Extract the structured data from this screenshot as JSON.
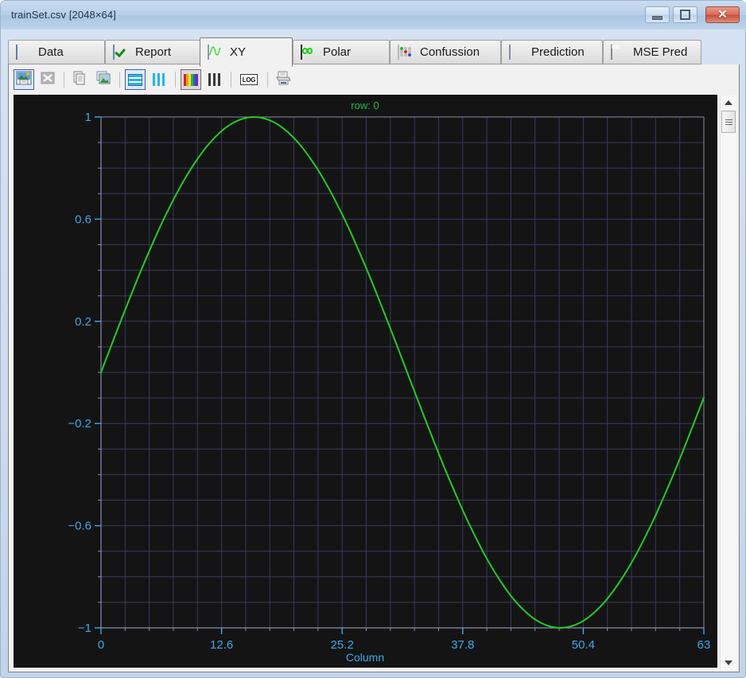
{
  "window": {
    "title": "trainSet.csv [2048×64]",
    "controls": {
      "minimize": "–",
      "maximize": "□",
      "close": "✕"
    }
  },
  "tabs": [
    {
      "label": "Data",
      "icon": "table-grid-icon",
      "active": false
    },
    {
      "label": "Report",
      "icon": "checkmark-icon",
      "active": false
    },
    {
      "label": "XY",
      "icon": "xy-waveform-icon",
      "active": true
    },
    {
      "label": "Polar",
      "icon": "polar-plot-icon",
      "active": false
    },
    {
      "label": "Confussion",
      "icon": "confusion-dots-icon",
      "active": false
    },
    {
      "label": "Prediction",
      "icon": "prediction-grid-icon",
      "active": false
    },
    {
      "label": "MSE Pred",
      "icon": "mse-grid-icon",
      "active": false
    }
  ],
  "toolbar": {
    "buttons": [
      {
        "name": "save-image-button",
        "icon": "save-image-icon",
        "enabled": true,
        "pressed": false,
        "framed": true
      },
      {
        "name": "export-excel-button",
        "icon": "excel-export-icon",
        "enabled": false,
        "pressed": false,
        "framed": false
      },
      {
        "name": "copy-data-button",
        "icon": "copy-pages-icon",
        "enabled": true,
        "pressed": false,
        "framed": false
      },
      {
        "name": "copy-image-button",
        "icon": "copy-image-icon",
        "enabled": true,
        "pressed": false,
        "framed": false
      },
      {
        "name": "horizontal-bars-button",
        "icon": "horizontal-bars-icon",
        "enabled": true,
        "pressed": false,
        "framed": true
      },
      {
        "name": "vertical-bars-button",
        "icon": "vertical-bars-icon",
        "enabled": true,
        "pressed": false,
        "framed": false
      },
      {
        "name": "color-palette-button",
        "icon": "color-bars-icon",
        "enabled": true,
        "pressed": true,
        "framed": false
      },
      {
        "name": "grayscale-palette-button",
        "icon": "gray-bars-icon",
        "enabled": true,
        "pressed": false,
        "framed": false
      },
      {
        "name": "log-scale-button",
        "icon": "log-icon",
        "enabled": true,
        "pressed": false,
        "framed": false,
        "label": "LOG"
      },
      {
        "name": "print-button",
        "icon": "printer-icon",
        "enabled": true,
        "pressed": false,
        "framed": false
      }
    ]
  },
  "scrollbar": {
    "up_arrow": "▲",
    "down_arrow": "▼"
  },
  "colors": {
    "plot_background": "#141414",
    "grid": "#39395f",
    "axis": "#8a8ab0",
    "series": "#22cc22",
    "tick_label": "#3aa9e8",
    "title": "#22bb44",
    "axis_label": "#3aa9e8"
  },
  "chart_data": {
    "type": "line",
    "title": "row: 0",
    "xlabel": "Column",
    "ylabel": "",
    "xlim": [
      0,
      63
    ],
    "ylim": [
      -1,
      1
    ],
    "xticks": [
      0,
      12.6,
      25.2,
      37.8,
      50.4,
      63
    ],
    "xtick_labels": [
      "0",
      "12.6",
      "25.2",
      "37.8",
      "50.4",
      "63"
    ],
    "yticks": [
      1,
      0.6,
      0.2,
      -0.2,
      -0.6,
      -1
    ],
    "ytick_labels": [
      "1",
      "0.6",
      "0.2",
      "−0.2",
      "−0.6",
      "−1"
    ],
    "x_minor_step": 2.52,
    "y_minor_step": 0.1,
    "grid": true,
    "legend": false,
    "series": [
      {
        "name": "row 0",
        "color": "#22cc22",
        "x": [
          0,
          1,
          2,
          3,
          4,
          5,
          6,
          7,
          8,
          9,
          10,
          11,
          12,
          13,
          14,
          15,
          16,
          17,
          18,
          19,
          20,
          21,
          22,
          23,
          24,
          25,
          26,
          27,
          28,
          29,
          30,
          31,
          32,
          33,
          34,
          35,
          36,
          37,
          38,
          39,
          40,
          41,
          42,
          43,
          44,
          45,
          46,
          47,
          48,
          49,
          50,
          51,
          52,
          53,
          54,
          55,
          56,
          57,
          58,
          59,
          60,
          61,
          62,
          63
        ],
        "y": [
          0.0,
          0.098,
          0.195,
          0.29,
          0.383,
          0.471,
          0.556,
          0.634,
          0.707,
          0.773,
          0.831,
          0.882,
          0.924,
          0.957,
          0.981,
          0.995,
          1.0,
          0.995,
          0.981,
          0.957,
          0.924,
          0.882,
          0.831,
          0.773,
          0.707,
          0.634,
          0.556,
          0.471,
          0.383,
          0.29,
          0.195,
          0.098,
          0.0,
          -0.098,
          -0.195,
          -0.29,
          -0.383,
          -0.471,
          -0.556,
          -0.634,
          -0.707,
          -0.773,
          -0.831,
          -0.882,
          -0.924,
          -0.957,
          -0.981,
          -0.995,
          -1.0,
          -0.995,
          -0.981,
          -0.957,
          -0.924,
          -0.882,
          -0.831,
          -0.773,
          -0.707,
          -0.634,
          -0.556,
          -0.471,
          -0.383,
          -0.29,
          -0.195,
          -0.098
        ]
      }
    ]
  }
}
